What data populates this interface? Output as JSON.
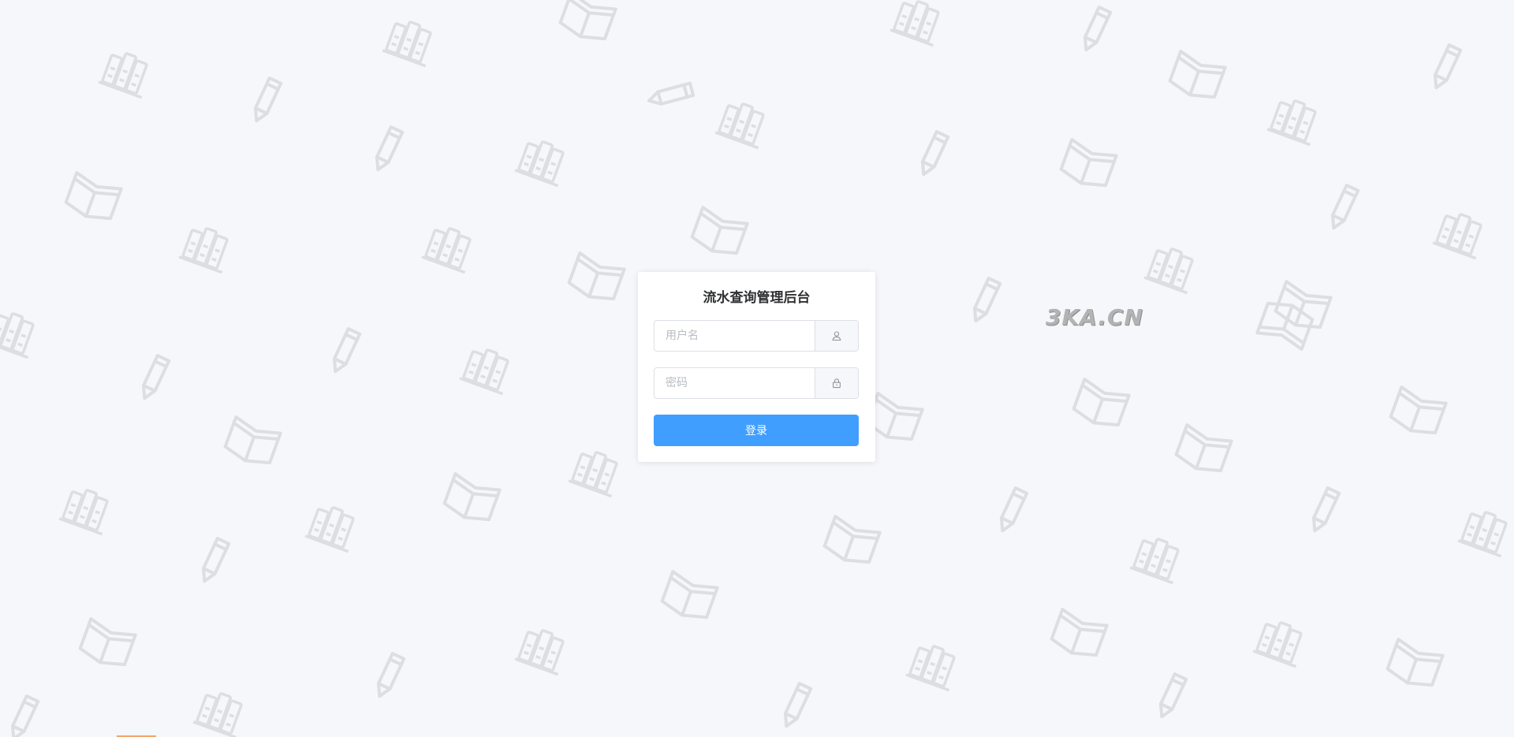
{
  "login": {
    "title": "流水查询管理后台",
    "username_placeholder": "用户名",
    "password_placeholder": "密码",
    "username_value": "",
    "password_value": "",
    "submit_label": "登录",
    "user_icon": "user-icon",
    "lock_icon": "lock-icon"
  },
  "watermark": {
    "text": "3KA.CN"
  },
  "theme": {
    "background": "#f5f7fb",
    "primary": "#409eff",
    "doodle_stroke": "#dcdee2"
  }
}
